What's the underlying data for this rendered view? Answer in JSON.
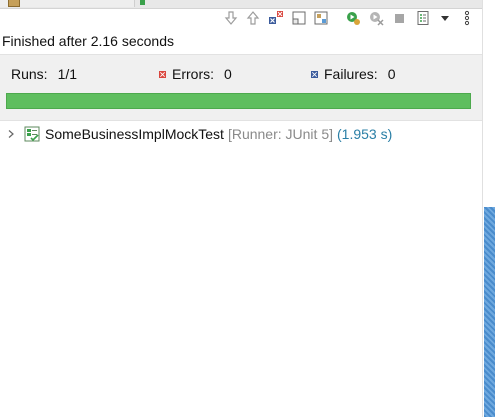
{
  "status": {
    "text": "Finished after 2.16 seconds"
  },
  "summary": {
    "runs_label": "Runs:",
    "runs_value": "1/1",
    "errors_label": "Errors:",
    "errors_value": "0",
    "failures_label": "Failures:",
    "failures_value": "0",
    "progress_fraction": 1.0,
    "progress_color": "#5fbe5f"
  },
  "toolbar": {
    "icons": [
      "next-failure-icon",
      "previous-failure-icon",
      "show-failures-only-icon",
      "scroll-lock-icon",
      "layout-icon",
      "rerun-test-icon",
      "rerun-failed-first-icon",
      "stop-icon",
      "history-icon",
      "view-menu-icon",
      "more-options-icon"
    ]
  },
  "tree": {
    "items": [
      {
        "name": "SomeBusinessImplMockTest",
        "runner": "[Runner: JUnit 5]",
        "time": "(1.953 s)"
      }
    ]
  },
  "colors": {
    "accent": "#2a7fa6",
    "success": "#5fbe5f",
    "error": "#d9463e",
    "failure": "#3b5b9c",
    "scroll_thumb": "#5b9bd5"
  }
}
